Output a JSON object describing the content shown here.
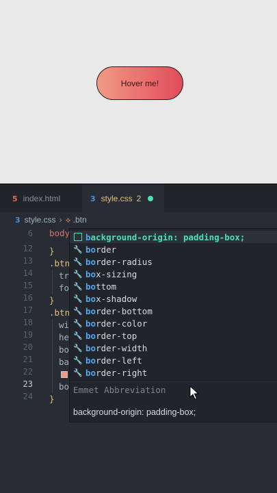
{
  "preview": {
    "button_label": "Hover me!"
  },
  "tabs": [
    {
      "label": "index.html",
      "icon": "html5-icon"
    },
    {
      "label": "style.css",
      "icon": "css3-icon",
      "problems": "2",
      "modified": true
    }
  ],
  "breadcrumb": {
    "file": "style.css",
    "symbol": ".btn"
  },
  "line_numbers": [
    "6",
    "12",
    "13",
    "14",
    "15",
    "16",
    "17",
    "18",
    "19",
    "20",
    "21",
    "22",
    "23",
    "24"
  ],
  "active_line": "23",
  "code": {
    "body": "body",
    "close1": "}",
    "btn1": ".btn",
    "tr": "tr",
    "fo": "fo",
    "close2": "}",
    "btn2": ".btn",
    "wi": "wi",
    "he": "he",
    "bo1": "bo",
    "ba": "ba",
    "bo2": "bo",
    "close3": "}"
  },
  "suggestions": [
    {
      "match": "b",
      "rest": "ackground-origin: padding-box;",
      "kind": "emmet",
      "selected": true
    },
    {
      "match": "bo",
      "rest": "rder",
      "kind": "property"
    },
    {
      "match": "bo",
      "rest": "rder-radius",
      "kind": "property"
    },
    {
      "match": "bo",
      "rest": "x-sizing",
      "kind": "property"
    },
    {
      "match": "bo",
      "rest": "ttom",
      "kind": "property"
    },
    {
      "match": "bo",
      "rest": "x-shadow",
      "kind": "property"
    },
    {
      "match": "bo",
      "rest": "rder-bottom",
      "kind": "property"
    },
    {
      "match": "bo",
      "rest": "rder-color",
      "kind": "property"
    },
    {
      "match": "bo",
      "rest": "rder-top",
      "kind": "property"
    },
    {
      "match": "bo",
      "rest": "rder-width",
      "kind": "property"
    },
    {
      "match": "bo",
      "rest": "rder-left",
      "kind": "property"
    },
    {
      "match": "bo",
      "rest": "rder-right",
      "kind": "property"
    }
  ],
  "details": {
    "title": "Emmet Abbreviation",
    "body": "background-origin: padding-box;"
  },
  "colors": {
    "accent": "#4ee0b2",
    "match": "#4fa8f0",
    "button_gradient_start": "#ef9b83",
    "button_gradient_end": "#de4d5b"
  }
}
